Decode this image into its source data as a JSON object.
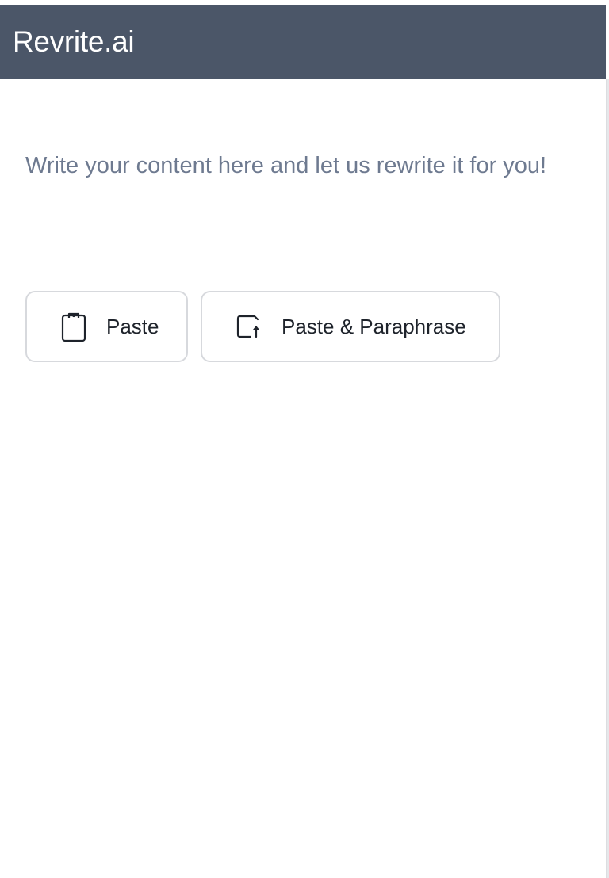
{
  "header": {
    "brand": "Revrite.ai"
  },
  "editor": {
    "placeholder": "Write your content here and let us rewrite it for you!"
  },
  "actions": {
    "paste": {
      "label": "Paste",
      "icon": "clipboard-icon"
    },
    "paste_paraphrase": {
      "label": "Paste & Paraphrase",
      "icon": "paste-upload-icon"
    }
  },
  "colors": {
    "header_bg": "#4b5668",
    "brand_text": "#ffffff",
    "placeholder_text": "#6e7a90",
    "button_border": "#d7d9dd",
    "button_text": "#1e232b"
  }
}
